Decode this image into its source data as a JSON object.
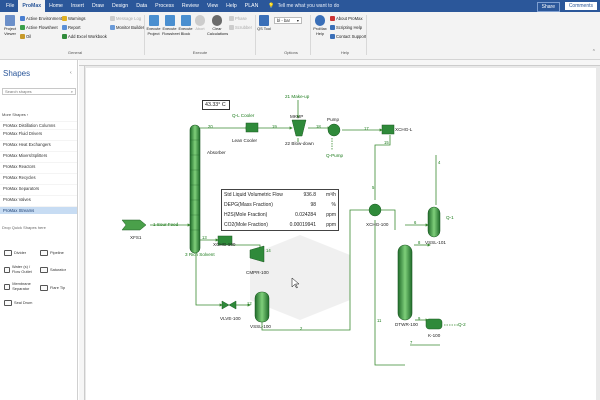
{
  "menu": {
    "tabs": [
      "File",
      "ProMax",
      "Home",
      "Insert",
      "Draw",
      "Design",
      "Data",
      "Process",
      "Review",
      "View",
      "Help",
      "PLAN"
    ],
    "active": "ProMax",
    "tell_me": "Tell me what you want to do",
    "share": "Share",
    "comments": "Comments"
  },
  "ribbon": {
    "project_viewer": "Project Viewer",
    "active_environment": "Active Environment",
    "active_flowsheet": "Active Flowsheet",
    "oil": "Oil",
    "warnings": "Warnings",
    "report": "Report",
    "add_excel_workbook": "Add Excel Workbook",
    "message_log": "Message Log",
    "monitor_builder": "Monitor Builder",
    "execute_project": "Execute Project",
    "execute_flowsheet": "Execute Flowsheet",
    "execute_block": "Execute Block",
    "abort": "Abort",
    "clear_calculations": "Clear Calculations",
    "phase": "Phase",
    "scrubber": "Scrubber",
    "qs_tool": "QS Tool",
    "units_value": "bl - bar",
    "promax_help": "ProMax Help",
    "about": "About ProMax",
    "scripting_help": "Scripting Help",
    "contact_support": "Contact Support",
    "groups": [
      "General",
      "Execute",
      "Options",
      "Help"
    ]
  },
  "sidebar": {
    "title": "Shapes",
    "search_placeholder": "Search shapes",
    "more_shapes": "More Shapes",
    "stencils": [
      "ProMax Distillation Columns",
      "ProMax Fluid Drivers",
      "ProMax Heat Exchangers",
      "ProMax Mixers/Splitters",
      "ProMax Reactors",
      "ProMax Recycles",
      "ProMax Separators",
      "ProMax Valves",
      "ProMax Streams"
    ],
    "selected": "ProMax Streams",
    "drop_hint": "Drop Quick Shapes here",
    "shapes": [
      "Divider",
      "Pipeline",
      "Water (s) / Flow Outlet",
      "Saturator",
      "Membrane Separator",
      "Flare Tip",
      "Seal Drum"
    ]
  },
  "flowsheet": {
    "temperature": "43.33° C",
    "labels": {
      "q_lcooler": "Q-L Cooler",
      "lean_cooler": "Lean Cooler",
      "makeup": "21 Make-up",
      "mkup": "MKUP",
      "pump": "Pump",
      "blowdown": "22 Blow-down",
      "q_pump": "Q-Pump",
      "xchg_l": "XCHG-L",
      "absorber": "Absorber",
      "sour_feed": "1 Sour Feed",
      "xfs1": "XFS1",
      "rich_solvent": "3 Rich Solvent",
      "xchg_100": "XCHG-100",
      "cmpr": "CMPR-100",
      "vlve": "VLVE-100",
      "vssl": "VSSL-100",
      "vssl101": "VSSL-101",
      "q1": "Q-1",
      "dtwr": "DTWR-100",
      "q2": "Q-2",
      "k100": "K-100",
      "xchg100b": "XCHG-100"
    },
    "stream_numbers": [
      "20",
      "19",
      "18",
      "17",
      "15",
      "13",
      "5",
      "6",
      "8",
      "4",
      "11",
      "7",
      "9",
      "12",
      "14",
      "2"
    ],
    "properties": [
      {
        "name": "Std Liquid Volumetric Flow",
        "value": "936.8",
        "unit": "m³/h"
      },
      {
        "name": "DEPG(Mass Fraction)",
        "value": "98",
        "unit": "%"
      },
      {
        "name": "H2S(Mole Fraction)",
        "value": "0.024284",
        "unit": "ppm"
      },
      {
        "name": "CO2(Mole Fraction)",
        "value": "0.00019941",
        "unit": "ppm"
      }
    ]
  },
  "colors": {
    "ribbon_blue": "#2b579a",
    "equipment_green": "#2f8a3a",
    "stream_green": "#4a9a3a"
  }
}
